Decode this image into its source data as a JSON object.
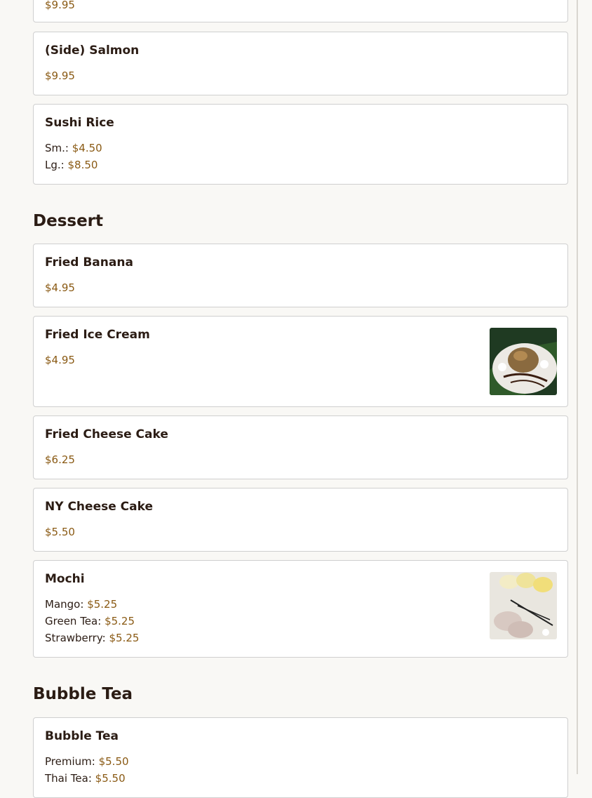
{
  "partial_top_price": "$9.95",
  "sections": [
    {
      "title": "Dessert"
    },
    {
      "title": "Bubble Tea"
    }
  ],
  "items": {
    "side_salmon": {
      "name": "(Side) Salmon",
      "price": "$9.95"
    },
    "sushi_rice": {
      "name": "Sushi Rice",
      "sm_label": "Sm.:",
      "sm_price": "$4.50",
      "lg_label": "Lg.:",
      "lg_price": "$8.50"
    },
    "fried_banana": {
      "name": "Fried Banana",
      "price": "$4.95"
    },
    "fried_ice_cream": {
      "name": "Fried Ice Cream",
      "price": "$4.95",
      "image": "fried-ice-cream-photo"
    },
    "fried_cheese_cake": {
      "name": "Fried Cheese Cake",
      "price": "$6.25"
    },
    "ny_cheese_cake": {
      "name": "NY Cheese Cake",
      "price": "$5.50"
    },
    "mochi": {
      "name": "Mochi",
      "image": "mochi-photo",
      "options": [
        {
          "label": "Mango:",
          "price": "$5.25"
        },
        {
          "label": "Green Tea:",
          "price": "$5.25"
        },
        {
          "label": "Strawberry:",
          "price": "$5.25"
        }
      ]
    },
    "bubble_tea": {
      "name": "Bubble Tea",
      "options": [
        {
          "label": "Premium:",
          "price": "$5.50"
        },
        {
          "label": "Thai Tea:",
          "price": "$5.50"
        }
      ]
    }
  },
  "colors": {
    "price": "#8a5a14",
    "text": "#2b1c14",
    "background": "#f9f8f5",
    "card_border": "#cfcfcf"
  }
}
